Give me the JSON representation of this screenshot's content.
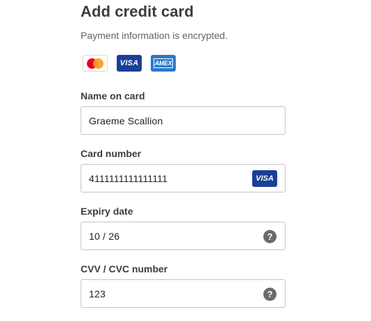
{
  "header": {
    "title": "Add credit card",
    "subtitle": "Payment information is encrypted."
  },
  "card_logos": [
    {
      "icon": "mastercard-logo-icon"
    },
    {
      "icon": "visa-logo-icon",
      "text": "VISA"
    },
    {
      "icon": "amex-logo-icon",
      "text": "AMEX"
    }
  ],
  "fields": {
    "name": {
      "label": "Name on card",
      "value": "Graeme Scallion"
    },
    "number": {
      "label": "Card number",
      "value": "4111111111111111",
      "brand_badge": "VISA"
    },
    "expiry": {
      "label": "Expiry date",
      "value": "10 / 26",
      "help_icon": "?"
    },
    "cvv": {
      "label": "CVV / CVC number",
      "value": "123",
      "help_icon": "?"
    }
  },
  "colors": {
    "visa_blue": "#1a3f97",
    "amex_blue": "#2a79c8",
    "mastercard_red": "#eb001b",
    "mastercard_orange": "#f79e1b",
    "help_icon_gray": "#6b6b6b"
  }
}
